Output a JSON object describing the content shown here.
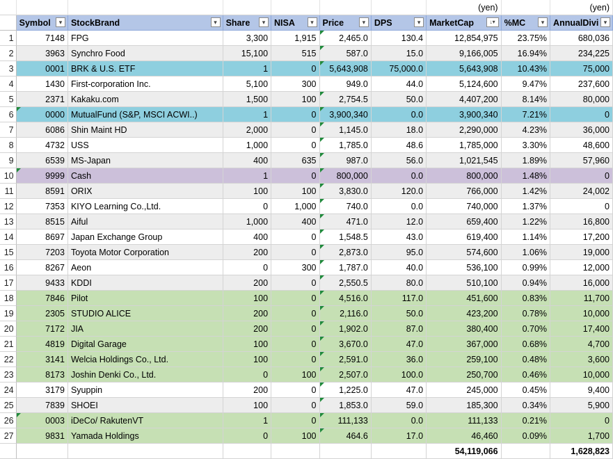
{
  "units": {
    "market_cap_unit": "(yen)",
    "annual_divi_unit": "(yen)"
  },
  "headers": {
    "symbol": "Symbol",
    "brand": "StockBrand",
    "share": "Share",
    "nisa": "NISA",
    "price": "Price",
    "dps": "DPS",
    "market_cap": "MarketCap",
    "pct_mc": "%MC",
    "annual_divi": "AnnualDivi"
  },
  "filter_icons": {
    "default": "▾",
    "sorted": "↓▾"
  },
  "colors": {
    "header": "#b4c6e7",
    "etf_blue": "#8ecfdf",
    "cash_purple": "#ccc0da",
    "green": "#c6e0b4",
    "gray": "#ededed",
    "error_marker": "#1f8a3b"
  },
  "rows": [
    {
      "n": "1",
      "symbol": "7148",
      "brand": "FPG",
      "share": "3,300",
      "nisa": "1,915",
      "price": "2,465.0",
      "dps": "130.4",
      "mc": "12,854,975",
      "pmc": "23.75%",
      "ad": "680,036",
      "bg": "w",
      "m": [
        "price"
      ]
    },
    {
      "n": "2",
      "symbol": "3963",
      "brand": "Synchro Food",
      "share": "15,100",
      "nisa": "515",
      "price": "587.0",
      "dps": "15.0",
      "mc": "9,166,005",
      "pmc": "16.94%",
      "ad": "234,225",
      "bg": "g",
      "m": [
        "price"
      ]
    },
    {
      "n": "3",
      "symbol": "0001",
      "brand": "BRK & U.S. ETF",
      "share": "1",
      "nisa": "0",
      "price": "5,643,908",
      "dps": "75,000.0",
      "mc": "5,643,908",
      "pmc": "10.43%",
      "ad": "75,000",
      "bg": "b",
      "m": [
        "price"
      ]
    },
    {
      "n": "4",
      "symbol": "1430",
      "brand": "First-corporation Inc.",
      "share": "5,100",
      "nisa": "300",
      "price": "949.0",
      "dps": "44.0",
      "mc": "5,124,600",
      "pmc": "9.47%",
      "ad": "237,600",
      "bg": "w",
      "m": []
    },
    {
      "n": "5",
      "symbol": "2371",
      "brand": "Kakaku.com",
      "share": "1,500",
      "nisa": "100",
      "price": "2,754.5",
      "dps": "50.0",
      "mc": "4,407,200",
      "pmc": "8.14%",
      "ad": "80,000",
      "bg": "g",
      "m": [
        "price"
      ]
    },
    {
      "n": "6",
      "symbol": "0000",
      "brand": "MutualFund (S&P, MSCI ACWI..)",
      "share": "1",
      "nisa": "0",
      "price": "3,900,340",
      "dps": "0.0",
      "mc": "3,900,340",
      "pmc": "7.21%",
      "ad": "0",
      "bg": "b",
      "m": [
        "symbol",
        "price"
      ]
    },
    {
      "n": "7",
      "symbol": "6086",
      "brand": "Shin Maint HD",
      "share": "2,000",
      "nisa": "0",
      "price": "1,145.0",
      "dps": "18.0",
      "mc": "2,290,000",
      "pmc": "4.23%",
      "ad": "36,000",
      "bg": "g",
      "m": [
        "price"
      ]
    },
    {
      "n": "8",
      "symbol": "4732",
      "brand": "USS",
      "share": "1,000",
      "nisa": "0",
      "price": "1,785.0",
      "dps": "48.6",
      "mc": "1,785,000",
      "pmc": "3.30%",
      "ad": "48,600",
      "bg": "w",
      "m": [
        "price"
      ]
    },
    {
      "n": "9",
      "symbol": "6539",
      "brand": "MS-Japan",
      "share": "400",
      "nisa": "635",
      "price": "987.0",
      "dps": "56.0",
      "mc": "1,021,545",
      "pmc": "1.89%",
      "ad": "57,960",
      "bg": "g",
      "m": [
        "price"
      ]
    },
    {
      "n": "10",
      "symbol": "9999",
      "brand": "Cash",
      "share": "1",
      "nisa": "0",
      "price": "800,000",
      "dps": "0.0",
      "mc": "800,000",
      "pmc": "1.48%",
      "ad": "0",
      "bg": "p",
      "m": [
        "symbol",
        "price"
      ]
    },
    {
      "n": "11",
      "symbol": "8591",
      "brand": "ORIX",
      "share": "100",
      "nisa": "100",
      "price": "3,830.0",
      "dps": "120.0",
      "mc": "766,000",
      "pmc": "1.42%",
      "ad": "24,002",
      "bg": "g",
      "m": [
        "price"
      ]
    },
    {
      "n": "12",
      "symbol": "7353",
      "brand": "KIYO Learning Co.,Ltd.",
      "share": "0",
      "nisa": "1,000",
      "price": "740.0",
      "dps": "0.0",
      "mc": "740,000",
      "pmc": "1.37%",
      "ad": "0",
      "bg": "w",
      "m": [
        "price"
      ]
    },
    {
      "n": "13",
      "symbol": "8515",
      "brand": "Aiful",
      "share": "1,000",
      "nisa": "400",
      "price": "471.0",
      "dps": "12.0",
      "mc": "659,400",
      "pmc": "1.22%",
      "ad": "16,800",
      "bg": "g",
      "m": [
        "price"
      ]
    },
    {
      "n": "14",
      "symbol": "8697",
      "brand": "Japan Exchange Group",
      "share": "400",
      "nisa": "0",
      "price": "1,548.5",
      "dps": "43.0",
      "mc": "619,400",
      "pmc": "1.14%",
      "ad": "17,200",
      "bg": "w",
      "m": [
        "price"
      ]
    },
    {
      "n": "15",
      "symbol": "7203",
      "brand": "Toyota Motor Corporation",
      "share": "200",
      "nisa": "0",
      "price": "2,873.0",
      "dps": "95.0",
      "mc": "574,600",
      "pmc": "1.06%",
      "ad": "19,000",
      "bg": "g",
      "m": [
        "price"
      ]
    },
    {
      "n": "16",
      "symbol": "8267",
      "brand": "Aeon",
      "share": "0",
      "nisa": "300",
      "price": "1,787.0",
      "dps": "40.0",
      "mc": "536,100",
      "pmc": "0.99%",
      "ad": "12,000",
      "bg": "w",
      "m": [
        "price"
      ]
    },
    {
      "n": "17",
      "symbol": "9433",
      "brand": "KDDI",
      "share": "200",
      "nisa": "0",
      "price": "2,550.5",
      "dps": "80.0",
      "mc": "510,100",
      "pmc": "0.94%",
      "ad": "16,000",
      "bg": "g",
      "m": [
        "price"
      ]
    },
    {
      "n": "18",
      "symbol": "7846",
      "brand": "Pilot",
      "share": "100",
      "nisa": "0",
      "price": "4,516.0",
      "dps": "117.0",
      "mc": "451,600",
      "pmc": "0.83%",
      "ad": "11,700",
      "bg": "l",
      "m": [
        "price"
      ]
    },
    {
      "n": "19",
      "symbol": "2305",
      "brand": "STUDIO ALICE",
      "share": "200",
      "nisa": "0",
      "price": "2,116.0",
      "dps": "50.0",
      "mc": "423,200",
      "pmc": "0.78%",
      "ad": "10,000",
      "bg": "l",
      "m": [
        "price"
      ]
    },
    {
      "n": "20",
      "symbol": "7172",
      "brand": "JIA",
      "share": "200",
      "nisa": "0",
      "price": "1,902.0",
      "dps": "87.0",
      "mc": "380,400",
      "pmc": "0.70%",
      "ad": "17,400",
      "bg": "l",
      "m": [
        "price"
      ]
    },
    {
      "n": "21",
      "symbol": "4819",
      "brand": "Digital Garage",
      "share": "100",
      "nisa": "0",
      "price": "3,670.0",
      "dps": "47.0",
      "mc": "367,000",
      "pmc": "0.68%",
      "ad": "4,700",
      "bg": "l",
      "m": [
        "price"
      ]
    },
    {
      "n": "22",
      "symbol": "3141",
      "brand": "Welcia Holdings Co., Ltd.",
      "share": "100",
      "nisa": "0",
      "price": "2,591.0",
      "dps": "36.0",
      "mc": "259,100",
      "pmc": "0.48%",
      "ad": "3,600",
      "bg": "l",
      "m": [
        "price"
      ]
    },
    {
      "n": "23",
      "symbol": "8173",
      "brand": "Joshin Denki Co., Ltd.",
      "share": "0",
      "nisa": "100",
      "price": "2,507.0",
      "dps": "100.0",
      "mc": "250,700",
      "pmc": "0.46%",
      "ad": "10,000",
      "bg": "l",
      "m": [
        "price"
      ]
    },
    {
      "n": "24",
      "symbol": "3179",
      "brand": "Syuppin",
      "share": "200",
      "nisa": "0",
      "price": "1,225.0",
      "dps": "47.0",
      "mc": "245,000",
      "pmc": "0.45%",
      "ad": "9,400",
      "bg": "w",
      "m": [
        "price"
      ]
    },
    {
      "n": "25",
      "symbol": "7839",
      "brand": "SHOEI",
      "share": "100",
      "nisa": "0",
      "price": "1,853.0",
      "dps": "59.0",
      "mc": "185,300",
      "pmc": "0.34%",
      "ad": "5,900",
      "bg": "g",
      "m": [
        "price"
      ]
    },
    {
      "n": "26",
      "symbol": "0003",
      "brand": "iDeCo/ RakutenVT",
      "share": "1",
      "nisa": "0",
      "price": "111,133",
      "dps": "0.0",
      "mc": "111,133",
      "pmc": "0.21%",
      "ad": "0",
      "bg": "l",
      "m": [
        "symbol",
        "price"
      ]
    },
    {
      "n": "27",
      "symbol": "9831",
      "brand": "Yamada Holdings",
      "share": "0",
      "nisa": "100",
      "price": "464.6",
      "dps": "17.0",
      "mc": "46,460",
      "pmc": "0.09%",
      "ad": "1,700",
      "bg": "l",
      "m": [
        "price"
      ]
    }
  ],
  "totals": {
    "market_cap": "54,119,066",
    "annual_divi": "1,628,823"
  }
}
